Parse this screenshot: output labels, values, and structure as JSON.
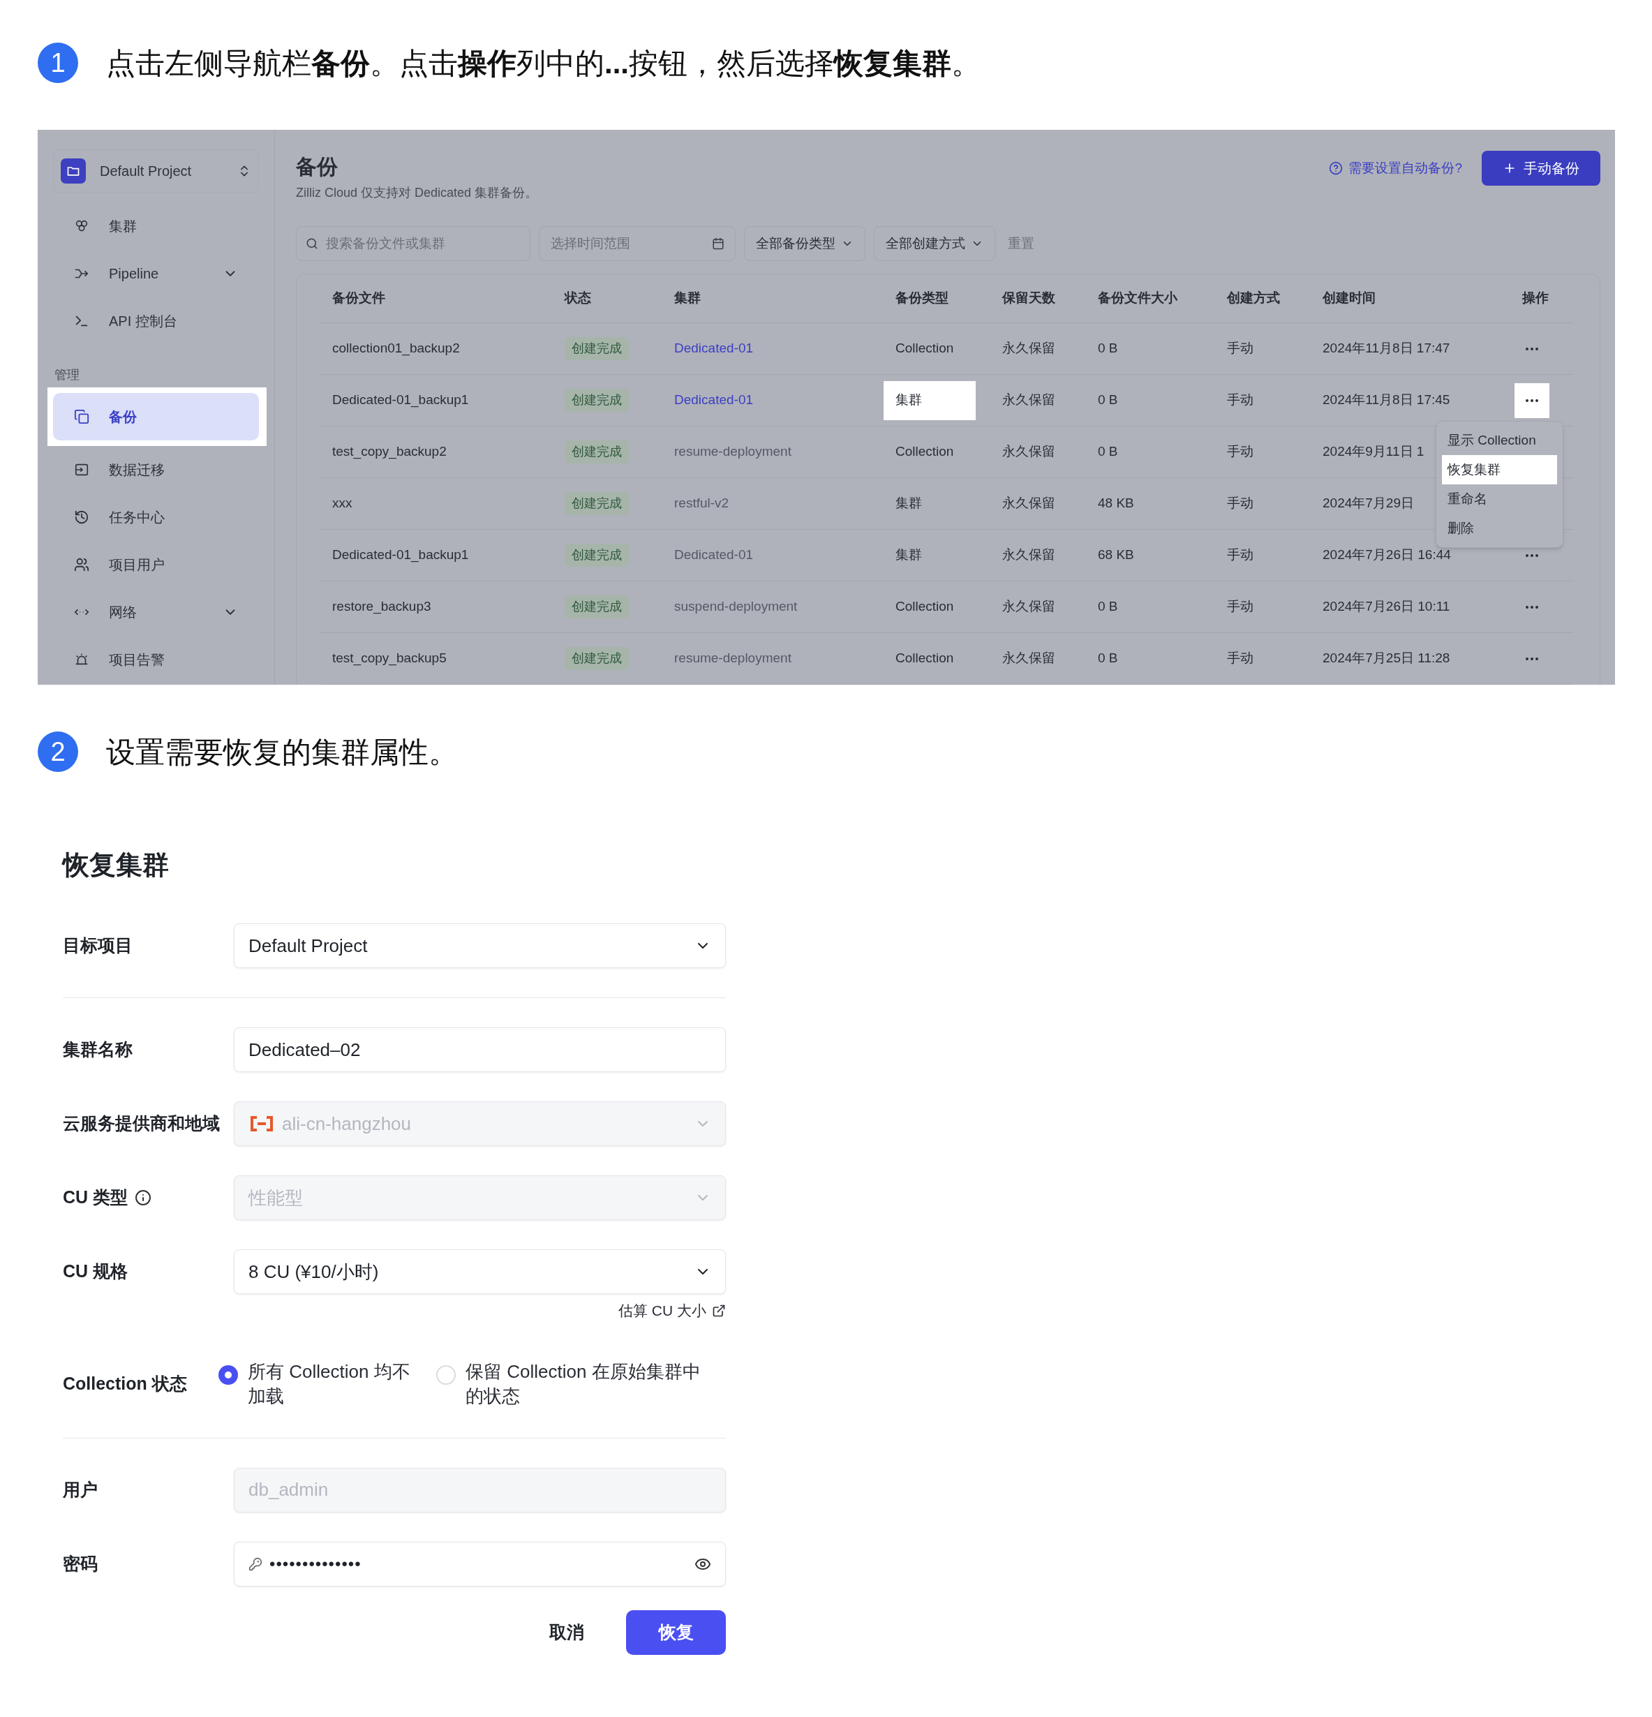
{
  "steps": [
    {
      "number": "1",
      "text": "点击左侧导航栏**备份**。点击**操作**列中的**...**按钮，然后选择**恢复集群**。"
    },
    {
      "number": "2",
      "text": "设置需要恢复的集群属性。"
    }
  ],
  "backup_screen": {
    "sidebar": {
      "project": "Default Project",
      "nav": [
        {
          "label": "集群",
          "expandable": false,
          "selected": false
        },
        {
          "label": "Pipeline",
          "expandable": true,
          "selected": false
        },
        {
          "label": "API 控制台",
          "expandable": false,
          "selected": false
        }
      ],
      "manage": {
        "title": "管理",
        "items": [
          {
            "label": "备份",
            "expandable": false,
            "selected": true,
            "highlighted": true
          },
          {
            "label": "数据迁移",
            "expandable": false,
            "selected": false,
            "highlighted": false
          },
          {
            "label": "任务中心",
            "expandable": false,
            "selected": false,
            "highlighted": false
          },
          {
            "label": "项目用户",
            "expandable": false,
            "selected": false,
            "highlighted": false
          },
          {
            "label": "网络",
            "expandable": true,
            "selected": false,
            "highlighted": false
          },
          {
            "label": "项目告警",
            "expandable": false,
            "selected": false,
            "highlighted": false
          }
        ]
      }
    },
    "title": "备份",
    "subtitle": "Zilliz Cloud 仅支持对 Dedicated 集群备份。",
    "help_link": "需要设置自动备份?",
    "create_button": "手动备份",
    "filters": {
      "search_placeholder": "搜索备份文件或集群",
      "date_placeholder": "选择时间范围",
      "type_filter": "全部备份类型",
      "method_filter": "全部创建方式",
      "reset": "重置"
    },
    "table": {
      "columns": [
        "备份文件",
        "状态",
        "集群",
        "备份类型",
        "保留天数",
        "备份文件大小",
        "创建方式",
        "创建时间",
        "操作"
      ],
      "rows": [
        {
          "file": "collection01_backup2",
          "status": "创建完成",
          "cluster": "Dedicated-01",
          "cluster_link": true,
          "type": {
            "text": "Collection",
            "highlighted": false
          },
          "retention": "永久保留",
          "size": "0 B",
          "method": "手动",
          "created": "2024年11月8日 17:47",
          "has_actions": true,
          "actions_highlighted": false
        },
        {
          "file": "Dedicated-01_backup1",
          "status": "创建完成",
          "cluster": "Dedicated-01",
          "cluster_link": true,
          "type": {
            "text": "集群",
            "highlighted": true
          },
          "retention": "永久保留",
          "size": "0 B",
          "method": "手动",
          "created": "2024年11月8日 17:45",
          "has_actions": true,
          "actions_highlighted": true,
          "menu": [
            {
              "label": "显示 Collection",
              "highlighted": false
            },
            {
              "label": "恢复集群",
              "highlighted": true
            },
            {
              "label": "重命名",
              "highlighted": false
            },
            {
              "label": "删除",
              "highlighted": false
            }
          ]
        },
        {
          "file": "test_copy_backup2",
          "status": "创建完成",
          "cluster": "resume-deployment",
          "cluster_link": false,
          "type": {
            "text": "Collection",
            "highlighted": false
          },
          "retention": "永久保留",
          "size": "0 B",
          "method": "手动",
          "created": "2024年9月11日 1"
        },
        {
          "file": "xxx",
          "status": "创建完成",
          "cluster": "restful-v2",
          "cluster_link": false,
          "type": {
            "text": "集群",
            "highlighted": false
          },
          "retention": "永久保留",
          "size": "48 KB",
          "method": "手动",
          "created": "2024年7月29日"
        },
        {
          "file": "Dedicated-01_backup1",
          "status": "创建完成",
          "cluster": "Dedicated-01",
          "cluster_link": false,
          "type": {
            "text": "集群",
            "highlighted": false
          },
          "retention": "永久保留",
          "size": "68 KB",
          "method": "手动",
          "created": "2024年7月26日 16:44",
          "has_actions": true,
          "actions_highlighted": false
        },
        {
          "file": "restore_backup3",
          "status": "创建完成",
          "cluster": "suspend-deployment",
          "cluster_link": false,
          "type": {
            "text": "Collection",
            "highlighted": false
          },
          "retention": "永久保留",
          "size": "0 B",
          "method": "手动",
          "created": "2024年7月26日 10:11",
          "has_actions": true,
          "actions_highlighted": false
        },
        {
          "file": "test_copy_backup5",
          "status": "创建完成",
          "cluster": "resume-deployment",
          "cluster_link": false,
          "type": {
            "text": "Collection",
            "highlighted": false
          },
          "retention": "永久保留",
          "size": "0 B",
          "method": "手动",
          "created": "2024年7月25日 11:28",
          "has_actions": true,
          "actions_highlighted": false
        }
      ]
    }
  },
  "restore_form": {
    "title": "恢复集群",
    "fields": [
      {
        "kind": "select",
        "label": "目标项目",
        "value": "Default Project",
        "disabled": false,
        "divider_after": true
      },
      {
        "kind": "input",
        "label": "集群名称",
        "value": "Dedicated–02",
        "disabled": false,
        "divider_after": false
      },
      {
        "kind": "region",
        "label": "云服务提供商和地域",
        "value": "ali-cn-hangzhou",
        "disabled": true,
        "divider_after": false
      },
      {
        "kind": "select",
        "label": "CU 类型",
        "info": true,
        "value": "性能型",
        "disabled": true,
        "divider_after": false
      },
      {
        "kind": "select",
        "label": "CU 规格",
        "value": "8 CU (¥10/小时)",
        "disabled": false,
        "link": "估算 CU 大小",
        "divider_after": false
      },
      {
        "kind": "radio",
        "label": "Collection 状态",
        "divider_after": true,
        "options": [
          {
            "label": "所有 Collection 均不加载",
            "selected": true
          },
          {
            "label": "保留 Collection 在原始集群中的状态",
            "selected": false
          }
        ]
      },
      {
        "kind": "input",
        "label": "用户",
        "value": "db_admin",
        "disabled": true,
        "divider_after": false
      },
      {
        "kind": "password",
        "label": "密码",
        "value": "••••••••••••••",
        "disabled": false,
        "divider_after": false
      }
    ],
    "cancel": "取消",
    "submit": "恢复"
  }
}
